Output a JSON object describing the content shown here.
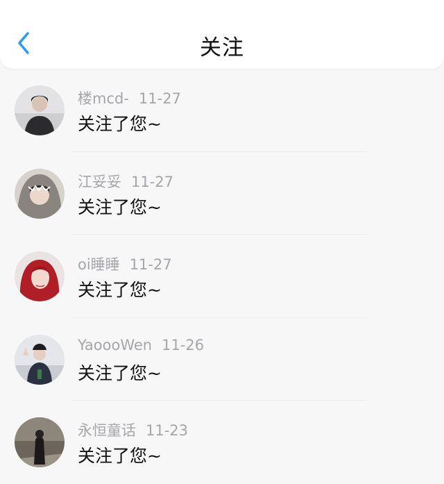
{
  "header": {
    "title": "关注"
  },
  "notifications": [
    {
      "name": "楼mcd-",
      "time": "11-27",
      "message": "关注了您~"
    },
    {
      "name": "江妥妥",
      "time": "11-27",
      "message": "关注了您~"
    },
    {
      "name": "oi睡睡",
      "time": "11-27",
      "message": "关注了您~"
    },
    {
      "name": "YaoooWen",
      "time": "11-26",
      "message": "关注了您~"
    },
    {
      "name": "永恒童话",
      "time": "11-23",
      "message": "关注了您~"
    }
  ],
  "colors": {
    "accent": "#2b9af3",
    "name_text": "#a6a6aa",
    "message_text": "#111111",
    "background": "#f7f7f8"
  },
  "icons": {
    "back": "chevron-left-icon"
  }
}
